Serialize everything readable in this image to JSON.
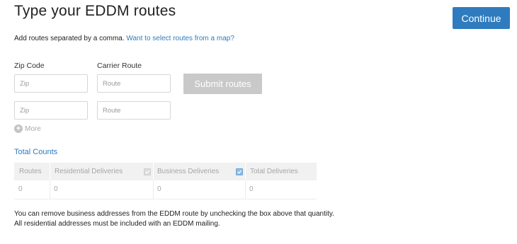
{
  "header": {
    "title": "Type your EDDM routes",
    "continue_label": "Continue"
  },
  "instructions": {
    "text": "Add routes separated by a comma.",
    "map_link": "Want to select routes from a map?"
  },
  "form": {
    "zip_label": "Zip Code",
    "route_label": "Carrier Route",
    "zip_placeholder": "Zip",
    "route_placeholder": "Route",
    "submit_label": "Submit routes",
    "more_label": "More"
  },
  "counts": {
    "title": "Total Counts",
    "headers": [
      "Routes",
      "Residential Deliveries",
      "Business Deliveries",
      "Total Deliveries"
    ],
    "values": [
      "0",
      "0",
      "0",
      "0"
    ],
    "residential_checked": true,
    "business_checked": true
  },
  "footer": {
    "line1": "You can remove business addresses from the EDDM route by unchecking the box above that quantity.",
    "line2": "All residential addresses must be included with an EDDM mailing."
  },
  "colors": {
    "accent": "#2f7bbf",
    "submit_disabled": "#c9c9c9",
    "table_header_bg": "#f1f1f1"
  }
}
